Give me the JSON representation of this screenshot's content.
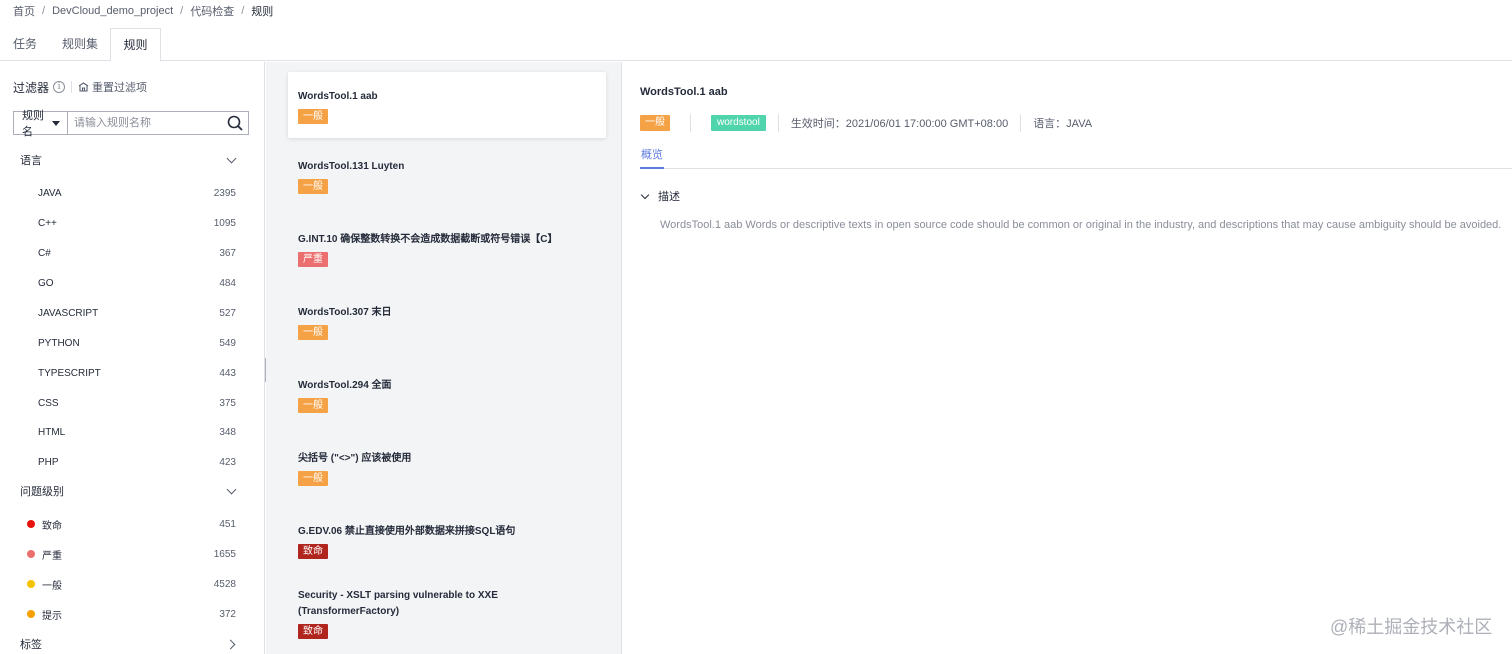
{
  "breadcrumb": {
    "items": [
      "首页",
      "DevCloud_demo_project",
      "代码检查",
      "规则"
    ],
    "separator": "/"
  },
  "tabs": {
    "items": [
      "任务",
      "规则集",
      "规则"
    ],
    "active": "规则"
  },
  "filter": {
    "title": "过滤器",
    "reset_label": "重置过滤项",
    "select_value": "规则名",
    "search_placeholder": "请输入规则名称",
    "language_section": "语言",
    "languages": [
      {
        "label": "JAVA",
        "count": "2395"
      },
      {
        "label": "C++",
        "count": "1095"
      },
      {
        "label": "C#",
        "count": "367"
      },
      {
        "label": "GO",
        "count": "484"
      },
      {
        "label": "JAVASCRIPT",
        "count": "527"
      },
      {
        "label": "PYTHON",
        "count": "549"
      },
      {
        "label": "TYPESCRIPT",
        "count": "443"
      },
      {
        "label": "CSS",
        "count": "375"
      },
      {
        "label": "HTML",
        "count": "348"
      },
      {
        "label": "PHP",
        "count": "423"
      }
    ],
    "severity_section": "问题级别",
    "severities": [
      {
        "label": "致命",
        "count": "451",
        "color": "#e8120c"
      },
      {
        "label": "严重",
        "count": "1655",
        "color": "#ec6f6f"
      },
      {
        "label": "一般",
        "count": "4528",
        "color": "#f5c200"
      },
      {
        "label": "提示",
        "count": "372",
        "color": "#f5a000"
      }
    ],
    "tag_section": "标签"
  },
  "rules": [
    {
      "name": "WordsTool.1 aab",
      "level": "一般"
    },
    {
      "name": "WordsTool.131 Luyten",
      "level": "一般"
    },
    {
      "name": "G.INT.10 确保整数转换不会造成数据截断或符号错误【C】",
      "level": "严重"
    },
    {
      "name": "WordsTool.307 末日",
      "level": "一般"
    },
    {
      "name": "WordsTool.294 全面",
      "level": "一般"
    },
    {
      "name": "尖括号 (\"<>\") 应该被使用",
      "level": "一般"
    },
    {
      "name": "G.EDV.06 禁止直接使用外部数据来拼接SQL语句",
      "level": "致命"
    },
    {
      "name": "Security - XSLT parsing vulnerable to XXE (TransformerFactory)",
      "level": "致命"
    }
  ],
  "detail": {
    "title": "WordsTool.1 aab",
    "level": "一般",
    "tag": "wordstool",
    "effective_time": "生效时间：2021/06/01 17:00:00 GMT+08:00",
    "language": "语言：JAVA",
    "tab": "概览",
    "desc_title": "描述",
    "description": "WordsTool.1 aab Words or descriptive texts in open source code should be common or original in the industry, and descriptions that may cause ambiguity should be avoided."
  },
  "watermark": "@稀土掘金技术社区"
}
